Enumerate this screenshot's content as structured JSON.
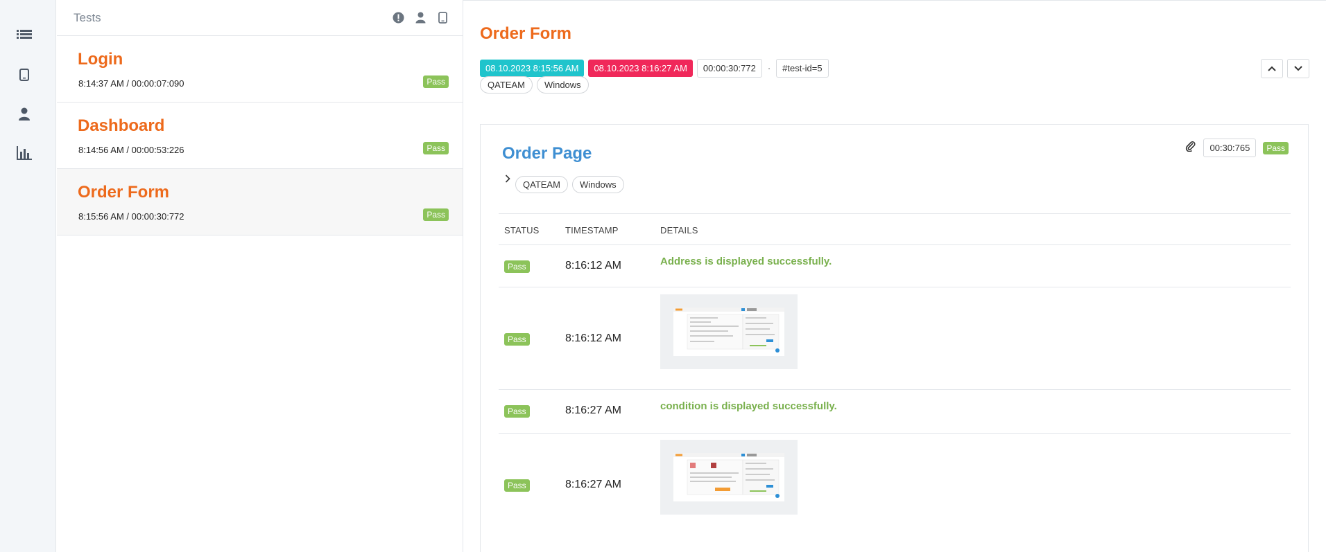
{
  "list": {
    "title": "Tests",
    "items": [
      {
        "name": "Login",
        "meta": "8:14:37 AM / 00:00:07:090",
        "status": "Pass"
      },
      {
        "name": "Dashboard",
        "meta": "8:14:56 AM / 00:00:53:226",
        "status": "Pass"
      },
      {
        "name": "Order Form",
        "meta": "8:15:56 AM / 00:00:30:772",
        "status": "Pass"
      }
    ]
  },
  "main": {
    "title": "Order Form",
    "start_time": "08.10.2023 8:15:56 AM",
    "end_time": "08.10.2023 8:16:27 AM",
    "duration": "00:00:30:772",
    "dot": "·",
    "test_id": "#test-id=5",
    "tags": [
      "QATEAM",
      "Windows"
    ]
  },
  "node": {
    "title": "Order Page",
    "duration": "00:30:765",
    "status": "Pass",
    "tags": [
      "QATEAM",
      "Windows"
    ]
  },
  "log": {
    "headers": {
      "status": "STATUS",
      "timestamp": "TIMESTAMP",
      "details": "DETAILS"
    },
    "rows": [
      {
        "status": "Pass",
        "timestamp": "8:16:12 AM",
        "details": "Address is displayed successfully."
      },
      {
        "status": "Pass",
        "timestamp": "8:16:12 AM",
        "details": ""
      },
      {
        "status": "Pass",
        "timestamp": "8:16:27 AM",
        "details": "condition is displayed successfully."
      },
      {
        "status": "Pass",
        "timestamp": "8:16:27 AM",
        "details": ""
      }
    ]
  },
  "icons": {
    "rail": [
      "list-icon",
      "tablet-icon",
      "user-icon",
      "bar-chart-icon"
    ],
    "header": [
      "exclamation-circle-icon",
      "user-icon",
      "tablet-icon"
    ],
    "colors": {
      "accent": "#ed6a1c",
      "link": "#3f8fd2",
      "pass": "#8cc35a",
      "start": "#1fc4cc",
      "end": "#f0285a"
    }
  }
}
